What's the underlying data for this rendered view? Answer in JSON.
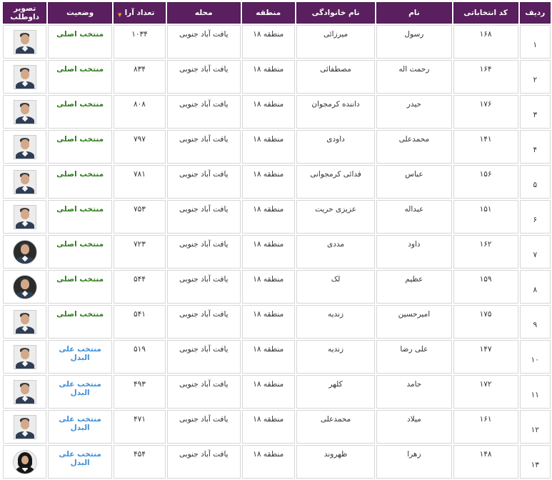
{
  "table": {
    "headers": {
      "row": "ردیف",
      "code": "کد انتخاباتی",
      "first_name": "نام",
      "last_name": "نام خانوادگی",
      "region": "منطقه",
      "neighborhood": "محله",
      "votes": "تعداد آرا",
      "status": "وضعیت",
      "photo": "تصویر داوطلب"
    },
    "sort_column": "votes",
    "colors": {
      "header_bg": "#5a1f5e",
      "status_primary": "#2e7d1e",
      "status_alt": "#3d8fd8",
      "sort_icon": "#f0a020"
    },
    "rows": [
      {
        "row": "۱",
        "code": "۱۶۸",
        "first_name": "رسول",
        "last_name": "میرزائی",
        "region": "منطقه ۱۸",
        "neighborhood": "یافت آباد جنوبی",
        "votes": "۱۰۳۴",
        "status": "منتخب اصلی",
        "status_type": "primary",
        "photo_icon": "person-photo-icon"
      },
      {
        "row": "۲",
        "code": "۱۶۴",
        "first_name": "رحمت اله",
        "last_name": "مصطفائی",
        "region": "منطقه ۱۸",
        "neighborhood": "یافت آباد جنوبی",
        "votes": "۸۳۴",
        "status": "منتخب اصلی",
        "status_type": "primary",
        "photo_icon": "person-photo-icon"
      },
      {
        "row": "۳",
        "code": "۱۷۶",
        "first_name": "حیدر",
        "last_name": "داننده کرمجوان",
        "region": "منطقه ۱۸",
        "neighborhood": "یافت آباد جنوبی",
        "votes": "۸۰۸",
        "status": "منتخب اصلی",
        "status_type": "primary",
        "photo_icon": "person-photo-icon"
      },
      {
        "row": "۴",
        "code": "۱۴۱",
        "first_name": "محمدعلی",
        "last_name": "داودی",
        "region": "منطقه ۱۸",
        "neighborhood": "یافت آباد جنوبی",
        "votes": "۷۹۷",
        "status": "منتخب اصلی",
        "status_type": "primary",
        "photo_icon": "person-photo-icon"
      },
      {
        "row": "۵",
        "code": "۱۵۶",
        "first_name": "عباس",
        "last_name": "فدائی کرمجوانی",
        "region": "منطقه ۱۸",
        "neighborhood": "یافت آباد جنوبی",
        "votes": "۷۸۱",
        "status": "منتخب اصلی",
        "status_type": "primary",
        "photo_icon": "person-photo-icon"
      },
      {
        "row": "۶",
        "code": "۱۵۱",
        "first_name": "عبداله",
        "last_name": "عزیزی حریت",
        "region": "منطقه ۱۸",
        "neighborhood": "یافت آباد جنوبی",
        "votes": "۷۵۳",
        "status": "منتخب اصلی",
        "status_type": "primary",
        "photo_icon": "person-photo-icon"
      },
      {
        "row": "۷",
        "code": "۱۶۲",
        "first_name": "داود",
        "last_name": "مددی",
        "region": "منطقه ۱۸",
        "neighborhood": "یافت آباد جنوبی",
        "votes": "۷۲۳",
        "status": "منتخب اصلی",
        "status_type": "primary",
        "photo_icon": "person-photo-icon"
      },
      {
        "row": "۸",
        "code": "۱۵۹",
        "first_name": "عظیم",
        "last_name": "لک",
        "region": "منطقه ۱۸",
        "neighborhood": "یافت آباد جنوبی",
        "votes": "۵۴۴",
        "status": "منتخب اصلی",
        "status_type": "primary",
        "photo_icon": "person-photo-icon"
      },
      {
        "row": "۹",
        "code": "۱۷۵",
        "first_name": "امیرحسین",
        "last_name": "زندیه",
        "region": "منطقه ۱۸",
        "neighborhood": "یافت آباد جنوبی",
        "votes": "۵۴۱",
        "status": "منتخب اصلی",
        "status_type": "primary",
        "photo_icon": "person-photo-icon"
      },
      {
        "row": "۱۰",
        "code": "۱۴۷",
        "first_name": "علی رضا",
        "last_name": "زندیه",
        "region": "منطقه ۱۸",
        "neighborhood": "یافت آباد جنوبی",
        "votes": "۵۱۹",
        "status": "منتخب علی البدل",
        "status_type": "alt",
        "photo_icon": "person-photo-icon"
      },
      {
        "row": "۱۱",
        "code": "۱۷۲",
        "first_name": "حامد",
        "last_name": "کلهر",
        "region": "منطقه ۱۸",
        "neighborhood": "یافت آباد جنوبی",
        "votes": "۴۹۳",
        "status": "منتخب علی البدل",
        "status_type": "alt",
        "photo_icon": "person-photo-icon"
      },
      {
        "row": "۱۲",
        "code": "۱۶۱",
        "first_name": "میلاد",
        "last_name": "محمدعلی",
        "region": "منطقه ۱۸",
        "neighborhood": "یافت آباد جنوبی",
        "votes": "۴۷۱",
        "status": "منتخب علی البدل",
        "status_type": "alt",
        "photo_icon": "person-photo-icon"
      },
      {
        "row": "۱۳",
        "code": "۱۴۸",
        "first_name": "زهرا",
        "last_name": "ظهروند",
        "region": "منطقه ۱۸",
        "neighborhood": "یافت آباد جنوبی",
        "votes": "۴۵۴",
        "status": "منتخب علی البدل",
        "status_type": "alt",
        "photo_icon": "person-photo-icon"
      }
    ]
  }
}
